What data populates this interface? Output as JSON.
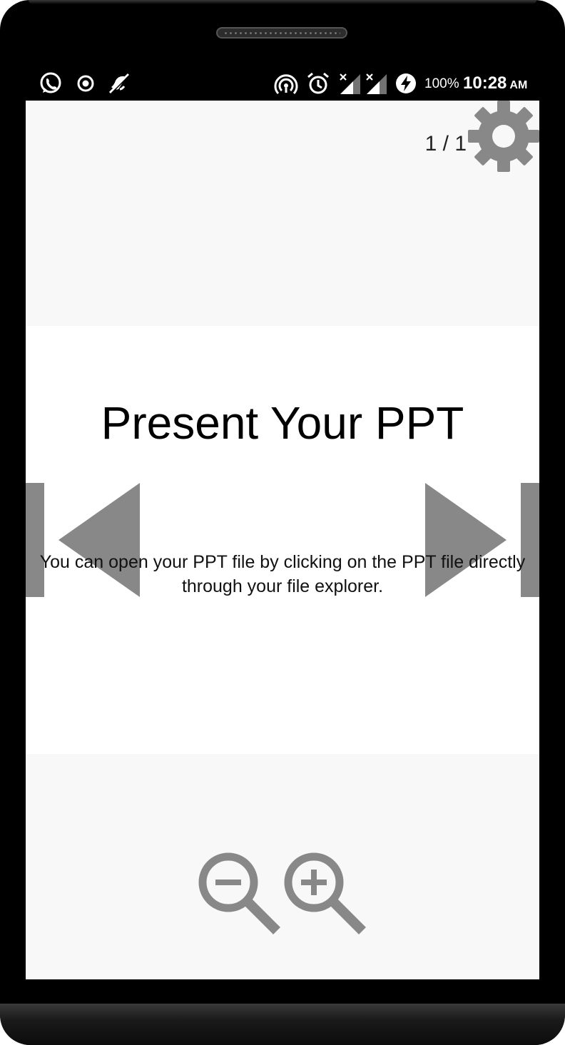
{
  "status_bar": {
    "left_icons": [
      "whatsapp-icon",
      "record-icon",
      "mute-icon"
    ],
    "right_icons": [
      "hotspot-icon",
      "alarm-icon",
      "signal-no-sim-1-icon",
      "signal-no-sim-2-icon",
      "battery-charging-icon"
    ],
    "battery_percent": "100%",
    "time": "10:28",
    "ampm": "AM"
  },
  "viewer": {
    "page_counter": "1 / 1",
    "settings_icon": "gear-icon",
    "nav_prev_icon": "triangle-left-icon",
    "nav_next_icon": "triangle-right-icon",
    "zoom_out_icon": "zoom-out-icon",
    "zoom_in_icon": "zoom-in-icon"
  },
  "slide": {
    "title": "Present Your PPT",
    "body": "You can open your PPT file by clicking on the PPT file directly through your file explorer."
  },
  "colors": {
    "control_gray": "#888888",
    "screen_bg": "#f8f8f8",
    "slide_bg": "#ffffff"
  }
}
